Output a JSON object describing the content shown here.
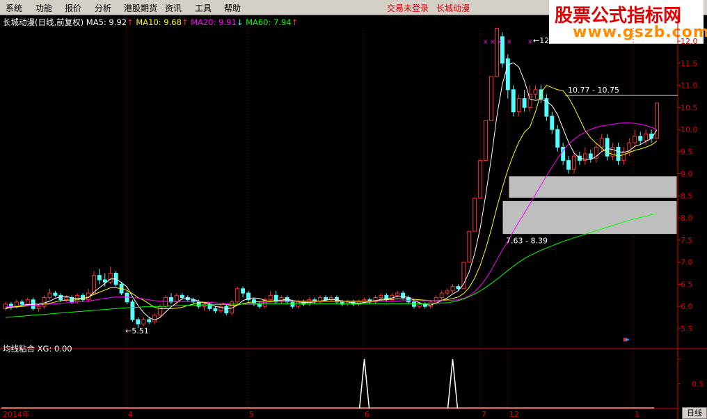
{
  "menu": [
    {
      "label": "系统"
    },
    {
      "label": "功能"
    },
    {
      "label": "报价"
    },
    {
      "label": "分析"
    },
    {
      "label": "港股期货"
    },
    {
      "label": "资讯"
    },
    {
      "label": "工具"
    },
    {
      "label": "帮助"
    }
  ],
  "status": {
    "login": "交易未登录",
    "stock": "长城动漫"
  },
  "logo": {
    "main": "股票公式指标网",
    "url": "www.gszb.com"
  },
  "info": {
    "title": "长城动漫(日线,前复权)",
    "ma5_label": "MA5: 9.92",
    "ma5_color": "#ffffff",
    "ma10_label": "MA10: 9.68",
    "ma10_color": "#ffff00",
    "ma20_label": "MA20: 9.91",
    "ma20_color": "#ff00ff",
    "ma60_label": "MA60: 7.94",
    "ma60_color": "#00ff00",
    "up_arrow": "↑",
    "down_arrow": "↓"
  },
  "sub": {
    "title": "均线粘合",
    "xg_label": "XG: 0.00"
  },
  "annotations": {
    "low": "←5.51",
    "high": "←12.29",
    "range1": "10.77 - 10.75",
    "range2": "7.63 - 8.39"
  },
  "colors": {
    "up": "#ff3232",
    "down": "#54ffff",
    "axis": "#e00000",
    "grid": "#880000",
    "ma5": "#ffffff",
    "ma10": "#ffff00",
    "ma20": "#ff00ff",
    "ma60": "#00ff00"
  },
  "day_button": "日线",
  "chart_data": {
    "type": "candlestick",
    "y_axis": {
      "ticks": [
        5.5,
        6.0,
        6.5,
        7.0,
        7.5,
        8.0,
        8.5,
        9.0,
        9.5,
        10.0,
        10.5,
        11.0,
        11.5,
        12.0
      ],
      "labels": [
        "5.5",
        "6.0",
        "6.5",
        "7.0",
        "7.5",
        "8.0",
        "8.5",
        "9.0",
        "9.5",
        "10.0",
        "10.5",
        "11.0",
        "11.5",
        "12.0"
      ],
      "ylim": [
        5.2,
        12.3
      ]
    },
    "x_axis": {
      "labels": [
        "2014年",
        "4",
        "5",
        "6",
        "7",
        "12",
        "1"
      ]
    },
    "sub_axis": {
      "ticks": [
        0.5,
        1.0
      ],
      "labels": [
        "0.5",
        "1"
      ]
    },
    "candles": [
      [
        5.95,
        6.05,
        5.9,
        6.1
      ],
      [
        6.05,
        5.98,
        5.92,
        6.1
      ],
      [
        5.98,
        6.1,
        5.95,
        6.15
      ],
      [
        6.1,
        6.05,
        6.0,
        6.15
      ],
      [
        6.05,
        6.15,
        6.0,
        6.2
      ],
      [
        6.15,
        5.95,
        5.9,
        6.2
      ],
      [
        5.95,
        6.0,
        5.88,
        6.05
      ],
      [
        6.0,
        6.2,
        5.95,
        6.25
      ],
      [
        6.2,
        6.3,
        6.15,
        6.4
      ],
      [
        6.3,
        6.25,
        6.2,
        6.35
      ],
      [
        6.25,
        6.15,
        6.1,
        6.3
      ],
      [
        6.15,
        6.2,
        6.1,
        6.25
      ],
      [
        6.2,
        6.1,
        6.05,
        6.25
      ],
      [
        6.1,
        6.25,
        6.05,
        6.3
      ],
      [
        6.25,
        6.15,
        6.1,
        6.3
      ],
      [
        6.15,
        6.3,
        6.1,
        6.4
      ],
      [
        6.3,
        6.7,
        6.25,
        6.8
      ],
      [
        6.7,
        6.6,
        6.5,
        6.85
      ],
      [
        6.6,
        6.55,
        6.45,
        6.75
      ],
      [
        6.55,
        6.75,
        6.5,
        6.9
      ],
      [
        6.75,
        6.5,
        6.45,
        6.8
      ],
      [
        6.5,
        6.3,
        6.25,
        6.55
      ],
      [
        6.3,
        6.1,
        6.05,
        6.35
      ],
      [
        6.1,
        5.7,
        5.65,
        6.15
      ],
      [
        5.7,
        5.6,
        5.51,
        5.75
      ],
      [
        5.6,
        5.7,
        5.55,
        5.75
      ],
      [
        5.7,
        5.65,
        5.6,
        5.75
      ],
      [
        5.65,
        5.8,
        5.6,
        5.85
      ],
      [
        5.8,
        6.0,
        5.75,
        6.05
      ],
      [
        6.0,
        6.2,
        5.95,
        6.25
      ],
      [
        6.2,
        6.1,
        6.05,
        6.3
      ],
      [
        6.1,
        6.25,
        6.05,
        6.3
      ],
      [
        6.25,
        6.2,
        6.15,
        6.3
      ],
      [
        6.2,
        6.15,
        6.1,
        6.25
      ],
      [
        6.15,
        6.1,
        6.05,
        6.2
      ],
      [
        6.1,
        6.0,
        5.95,
        6.15
      ],
      [
        6.0,
        6.05,
        5.9,
        6.1
      ],
      [
        6.05,
        5.95,
        5.9,
        6.1
      ],
      [
        5.95,
        5.9,
        5.85,
        6.0
      ],
      [
        5.9,
        6.0,
        5.85,
        6.05
      ],
      [
        6.0,
        5.85,
        5.8,
        6.05
      ],
      [
        5.85,
        6.1,
        5.8,
        6.15
      ],
      [
        6.1,
        6.4,
        6.05,
        6.45
      ],
      [
        6.4,
        6.3,
        6.2,
        6.45
      ],
      [
        6.3,
        6.15,
        6.1,
        6.35
      ],
      [
        6.15,
        6.05,
        6.0,
        6.2
      ],
      [
        6.05,
        6.0,
        5.95,
        6.1
      ],
      [
        6.0,
        6.15,
        5.95,
        6.2
      ],
      [
        6.15,
        6.25,
        6.1,
        6.35
      ],
      [
        6.25,
        6.1,
        6.05,
        6.35
      ],
      [
        6.1,
        6.2,
        6.05,
        6.25
      ],
      [
        6.2,
        6.1,
        6.05,
        6.25
      ],
      [
        6.1,
        6.0,
        5.95,
        6.15
      ],
      [
        6.0,
        6.1,
        5.95,
        6.15
      ],
      [
        6.1,
        6.05,
        6.0,
        6.15
      ],
      [
        6.05,
        6.15,
        6.0,
        6.2
      ],
      [
        6.15,
        6.1,
        6.05,
        6.2
      ],
      [
        6.1,
        6.2,
        6.05,
        6.25
      ],
      [
        6.2,
        6.15,
        6.1,
        6.25
      ],
      [
        6.15,
        6.2,
        6.1,
        6.25
      ],
      [
        6.2,
        6.1,
        6.05,
        6.25
      ],
      [
        6.1,
        6.05,
        6.0,
        6.15
      ],
      [
        6.05,
        6.1,
        6.0,
        6.15
      ],
      [
        6.1,
        6.05,
        6.0,
        6.15
      ],
      [
        6.05,
        6.1,
        6.0,
        6.15
      ],
      [
        6.1,
        6.15,
        6.05,
        6.2
      ],
      [
        6.15,
        6.1,
        6.05,
        6.2
      ],
      [
        6.1,
        6.2,
        6.05,
        6.25
      ],
      [
        6.2,
        6.25,
        6.15,
        6.3
      ],
      [
        6.25,
        6.15,
        6.1,
        6.3
      ],
      [
        6.15,
        6.25,
        6.1,
        6.3
      ],
      [
        6.25,
        6.3,
        6.2,
        6.35
      ],
      [
        6.3,
        6.2,
        6.15,
        6.35
      ],
      [
        6.2,
        6.1,
        6.05,
        6.25
      ],
      [
        6.1,
        6.0,
        5.95,
        6.15
      ],
      [
        6.0,
        6.05,
        5.95,
        6.1
      ],
      [
        6.05,
        6.0,
        5.95,
        6.1
      ],
      [
        6.0,
        6.1,
        5.95,
        6.15
      ],
      [
        6.1,
        6.2,
        6.05,
        6.25
      ],
      [
        6.2,
        6.3,
        6.15,
        6.35
      ],
      [
        6.3,
        6.35,
        6.25,
        6.4
      ],
      [
        6.35,
        6.45,
        6.3,
        6.5
      ],
      [
        6.45,
        6.4,
        6.35,
        6.5
      ],
      [
        6.4,
        7.0,
        6.4,
        7.0
      ],
      [
        7.0,
        7.7,
        7.0,
        7.7
      ],
      [
        7.7,
        8.45,
        7.7,
        8.45
      ],
      [
        8.45,
        9.3,
        8.45,
        9.3
      ],
      [
        9.3,
        10.2,
        9.3,
        10.2
      ],
      [
        10.2,
        11.2,
        10.2,
        11.2
      ],
      [
        11.2,
        12.29,
        11.2,
        12.29
      ],
      [
        12.1,
        11.5,
        11.4,
        12.2
      ],
      [
        11.6,
        10.9,
        10.7,
        11.7
      ],
      [
        10.9,
        10.4,
        10.3,
        11.0
      ],
      [
        10.4,
        10.7,
        10.3,
        10.8
      ],
      [
        10.7,
        10.5,
        10.4,
        10.9
      ],
      [
        10.5,
        10.8,
        10.4,
        11.0
      ],
      [
        10.8,
        10.9,
        10.7,
        11.0
      ],
      [
        10.9,
        10.7,
        10.6,
        11.0
      ],
      [
        10.7,
        10.3,
        10.2,
        10.8
      ],
      [
        10.3,
        10.0,
        9.9,
        10.4
      ],
      [
        10.0,
        9.6,
        9.5,
        10.1
      ],
      [
        9.6,
        9.3,
        9.2,
        9.7
      ],
      [
        9.3,
        9.1,
        9.0,
        9.4
      ],
      [
        9.1,
        9.4,
        9.0,
        9.5
      ],
      [
        9.4,
        9.3,
        9.2,
        9.5
      ],
      [
        9.3,
        9.45,
        9.2,
        9.6
      ],
      [
        9.45,
        9.35,
        9.25,
        9.55
      ],
      [
        9.35,
        9.6,
        9.25,
        9.7
      ],
      [
        9.6,
        9.8,
        9.5,
        9.9
      ],
      [
        9.8,
        9.4,
        9.3,
        9.9
      ],
      [
        9.4,
        9.6,
        9.3,
        9.7
      ],
      [
        9.6,
        9.3,
        9.2,
        9.7
      ],
      [
        9.3,
        9.5,
        9.2,
        9.6
      ],
      [
        9.5,
        9.7,
        9.4,
        9.8
      ],
      [
        9.7,
        9.85,
        9.6,
        10.0
      ],
      [
        9.85,
        9.75,
        9.65,
        9.95
      ],
      [
        9.75,
        9.9,
        9.65,
        10.0
      ],
      [
        9.9,
        9.8,
        9.7,
        10.0
      ],
      [
        9.8,
        10.6,
        9.8,
        10.6
      ]
    ],
    "ma_series": [
      {
        "name": "MA5",
        "values": [
          5.95,
          5.98,
          6.0,
          6.03,
          6.04,
          6.05,
          6.05,
          6.08,
          6.12,
          6.18,
          6.22,
          6.23,
          6.19,
          6.18,
          6.18,
          6.2,
          6.32,
          6.42,
          6.52,
          6.62,
          6.62,
          6.54,
          6.44,
          6.22,
          6.02,
          5.86,
          5.75,
          5.69,
          5.75,
          5.87,
          5.99,
          6.08,
          6.17,
          6.18,
          6.16,
          6.12,
          6.08,
          6.05,
          6.0,
          5.98,
          5.95,
          5.96,
          6.03,
          6.13,
          6.18,
          6.19,
          6.18,
          6.13,
          6.11,
          6.13,
          6.14,
          6.17,
          6.13,
          6.1,
          6.09,
          6.09,
          6.1,
          6.12,
          6.14,
          6.16,
          6.15,
          6.12,
          6.1,
          6.08,
          6.07,
          6.09,
          6.1,
          6.12,
          6.16,
          6.17,
          6.19,
          6.23,
          6.23,
          6.2,
          6.14,
          6.08,
          6.04,
          6.03,
          6.07,
          6.13,
          6.19,
          6.28,
          6.35,
          6.51,
          6.78,
          7.2,
          7.78,
          8.53,
          9.35,
          10.3,
          11.03,
          11.46,
          11.51,
          11.41,
          11.1,
          10.69,
          10.66,
          10.68,
          10.64,
          10.54,
          10.34,
          10.02,
          9.71,
          9.47,
          9.35,
          9.33,
          9.32,
          9.39,
          9.5,
          9.57,
          9.55,
          9.5,
          9.48,
          9.52,
          9.62,
          9.66,
          9.73,
          9.8,
          9.99
        ]
      },
      {
        "name": "MA10",
        "values": [
          5.97,
          5.98,
          5.99,
          6.0,
          6.01,
          6.02,
          6.03,
          6.05,
          6.07,
          6.1,
          6.13,
          6.14,
          6.14,
          6.15,
          6.18,
          6.21,
          6.27,
          6.32,
          6.37,
          6.42,
          6.42,
          6.4,
          6.36,
          6.29,
          6.2,
          6.14,
          6.06,
          5.98,
          5.95,
          5.95,
          5.95,
          5.96,
          5.98,
          6.02,
          6.05,
          6.08,
          6.09,
          6.09,
          6.08,
          6.07,
          6.04,
          6.02,
          6.03,
          6.06,
          6.09,
          6.1,
          6.11,
          6.12,
          6.12,
          6.13,
          6.14,
          6.14,
          6.13,
          6.12,
          6.12,
          6.12,
          6.12,
          6.12,
          6.12,
          6.12,
          6.12,
          6.12,
          6.12,
          6.12,
          6.12,
          6.12,
          6.12,
          6.13,
          6.14,
          6.15,
          6.16,
          6.17,
          6.17,
          6.17,
          6.16,
          6.15,
          6.14,
          6.13,
          6.13,
          6.14,
          6.15,
          6.18,
          6.21,
          6.29,
          6.43,
          6.64,
          6.93,
          7.31,
          7.74,
          8.24,
          8.68,
          9.09,
          9.43,
          9.72,
          9.94,
          10.06,
          10.4,
          10.83,
          11.0,
          10.95,
          10.9,
          10.88,
          10.72,
          10.5,
          10.24,
          9.98,
          9.81,
          9.69,
          9.58,
          9.48,
          9.44,
          9.4,
          9.43,
          9.48,
          9.53,
          9.56,
          9.6,
          9.65,
          9.74
        ]
      },
      {
        "name": "MA20",
        "values": [
          6.0,
          6.0,
          6.01,
          6.01,
          6.02,
          6.02,
          6.03,
          6.04,
          6.05,
          6.06,
          6.07,
          6.08,
          6.09,
          6.1,
          6.11,
          6.12,
          6.14,
          6.16,
          6.18,
          6.2,
          6.21,
          6.21,
          6.21,
          6.2,
          6.19,
          6.17,
          6.15,
          6.13,
          6.12,
          6.11,
          6.11,
          6.11,
          6.11,
          6.11,
          6.11,
          6.11,
          6.1,
          6.09,
          6.08,
          6.07,
          6.06,
          6.05,
          6.05,
          6.05,
          6.06,
          6.07,
          6.08,
          6.09,
          6.1,
          6.1,
          6.11,
          6.11,
          6.11,
          6.11,
          6.11,
          6.11,
          6.11,
          6.11,
          6.11,
          6.11,
          6.11,
          6.11,
          6.11,
          6.11,
          6.11,
          6.11,
          6.11,
          6.11,
          6.11,
          6.12,
          6.12,
          6.12,
          6.13,
          6.13,
          6.13,
          6.13,
          6.13,
          6.13,
          6.13,
          6.13,
          6.13,
          6.14,
          6.15,
          6.18,
          6.24,
          6.33,
          6.46,
          6.62,
          6.82,
          7.05,
          7.27,
          7.48,
          7.7,
          7.91,
          8.11,
          8.32,
          8.53,
          8.74,
          8.95,
          9.15,
          9.34,
          9.52,
          9.67,
          9.78,
          9.87,
          9.94,
          10.0,
          10.05,
          10.08,
          10.1,
          10.12,
          10.14,
          10.15,
          10.15,
          10.14,
          10.12,
          10.09,
          10.05,
          10.0
        ]
      },
      {
        "name": "MA60",
        "values": [
          5.75,
          5.76,
          5.77,
          5.78,
          5.79,
          5.8,
          5.81,
          5.82,
          5.83,
          5.84,
          5.85,
          5.86,
          5.87,
          5.88,
          5.89,
          5.9,
          5.91,
          5.92,
          5.93,
          5.94,
          5.95,
          5.96,
          5.97,
          5.98,
          5.98,
          5.99,
          5.99,
          6.0,
          6.0,
          6.0,
          6.01,
          6.01,
          6.02,
          6.02,
          6.02,
          6.03,
          6.03,
          6.03,
          6.04,
          6.04,
          6.04,
          6.05,
          6.05,
          6.05,
          6.05,
          6.05,
          6.06,
          6.06,
          6.06,
          6.06,
          6.06,
          6.06,
          6.06,
          6.06,
          6.06,
          6.06,
          6.06,
          6.06,
          6.06,
          6.06,
          6.06,
          6.06,
          6.06,
          6.06,
          6.06,
          6.06,
          6.06,
          6.06,
          6.06,
          6.06,
          6.06,
          6.06,
          6.06,
          6.06,
          6.06,
          6.06,
          6.06,
          6.07,
          6.07,
          6.08,
          6.08,
          6.1,
          6.13,
          6.17,
          6.22,
          6.28,
          6.35,
          6.43,
          6.52,
          6.61,
          6.71,
          6.81,
          6.91,
          7.0,
          7.08,
          7.15,
          7.21,
          7.27,
          7.32,
          7.37,
          7.42,
          7.47,
          7.51,
          7.55,
          7.59,
          7.63,
          7.67,
          7.71,
          7.75,
          7.79,
          7.83,
          7.87,
          7.91,
          7.95,
          7.98,
          8.01,
          8.04,
          8.07,
          8.1
        ]
      }
    ],
    "zones": [
      {
        "from": 8.45,
        "to": 8.95,
        "color": "#bebebe"
      },
      {
        "from": 7.63,
        "to": 8.39,
        "color": "#bebebe"
      }
    ],
    "sub_spikes": [
      {
        "index": 65,
        "value": 1.0
      },
      {
        "index": 81,
        "value": 1.0
      }
    ]
  }
}
